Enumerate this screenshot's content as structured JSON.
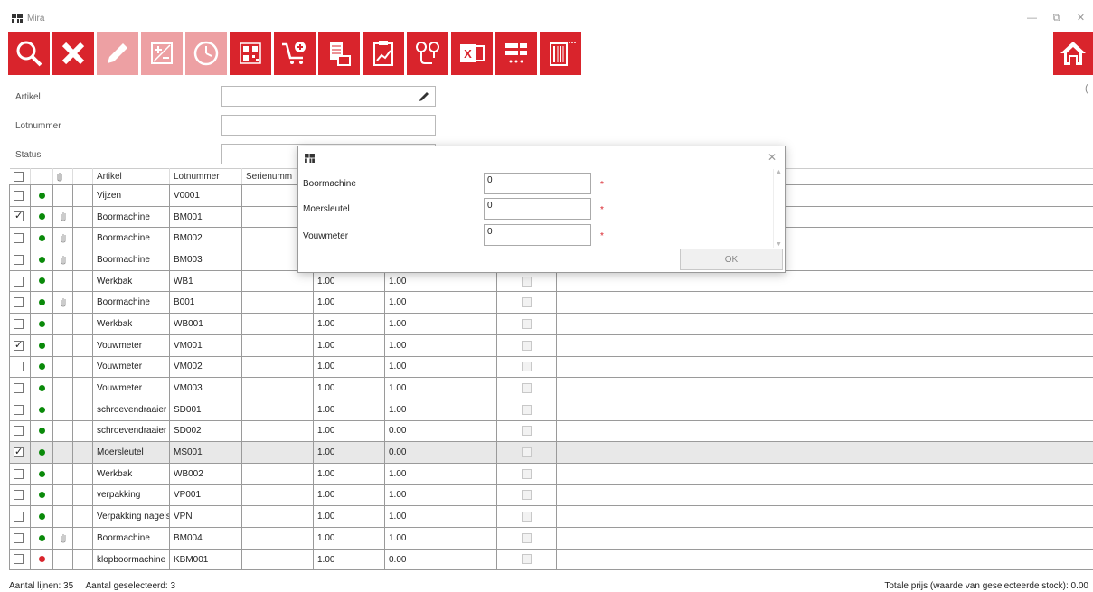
{
  "window": {
    "title": "Mira",
    "minimize": "—",
    "restore": "⧉",
    "close": "✕"
  },
  "toolbar": {
    "buttons": [
      {
        "icon": "search-icon",
        "name": "search-button",
        "disabled": false
      },
      {
        "icon": "close-icon",
        "name": "delete-button",
        "disabled": false
      },
      {
        "icon": "pencil-icon",
        "name": "edit-button",
        "disabled": true
      },
      {
        "icon": "plus-minus-icon",
        "name": "adjust-button",
        "disabled": true
      },
      {
        "icon": "clock-icon",
        "name": "history-button",
        "disabled": true
      },
      {
        "icon": "qr-code-icon",
        "name": "qr-button",
        "disabled": false
      },
      {
        "icon": "cart-add-icon",
        "name": "add-to-cart-button",
        "disabled": false
      },
      {
        "icon": "document-box-icon",
        "name": "document-button",
        "disabled": false
      },
      {
        "icon": "clipboard-chart-icon",
        "name": "report-button",
        "disabled": false
      },
      {
        "icon": "location-route-icon",
        "name": "route-button",
        "disabled": false
      },
      {
        "icon": "excel-icon",
        "name": "excel-button",
        "disabled": false
      },
      {
        "icon": "list-settings-icon",
        "name": "list-settings-button",
        "disabled": false
      },
      {
        "icon": "barcode-icon",
        "name": "barcode-button",
        "disabled": false
      }
    ],
    "home_icon": "home-icon",
    "accent": "#d9242c"
  },
  "filters": {
    "artikel_label": "Artikel",
    "lotnummer_label": "Lotnummer",
    "status_label": "Status",
    "artikel_value": "",
    "lotnummer_value": "",
    "status_value": ""
  },
  "grid": {
    "headers": [
      "Artikel",
      "Lotnummer",
      "Serienumm",
      "",
      "",
      ""
    ],
    "rows": [
      {
        "checked": false,
        "status": "green",
        "clip": false,
        "artikel": "Vijzen",
        "lot": "V0001",
        "serie": "",
        "a": "",
        "b": "",
        "box": false
      },
      {
        "checked": true,
        "status": "green",
        "clip": true,
        "artikel": "Boormachine",
        "lot": "BM001",
        "serie": "",
        "a": "",
        "b": "",
        "box": false
      },
      {
        "checked": false,
        "status": "green",
        "clip": true,
        "artikel": "Boormachine",
        "lot": "BM002",
        "serie": "",
        "a": "",
        "b": "",
        "box": false
      },
      {
        "checked": false,
        "status": "green",
        "clip": true,
        "artikel": "Boormachine",
        "lot": "BM003",
        "serie": "",
        "a": "",
        "b": "",
        "box": false
      },
      {
        "checked": false,
        "status": "green",
        "clip": false,
        "artikel": "Werkbak",
        "lot": "WB1",
        "serie": "",
        "a": "1.00",
        "b": "1.00",
        "box": true
      },
      {
        "checked": false,
        "status": "green",
        "clip": true,
        "artikel": "Boormachine",
        "lot": "B001",
        "serie": "",
        "a": "1.00",
        "b": "1.00",
        "box": true
      },
      {
        "checked": false,
        "status": "green",
        "clip": false,
        "artikel": "Werkbak",
        "lot": "WB001",
        "serie": "",
        "a": "1.00",
        "b": "1.00",
        "box": true
      },
      {
        "checked": true,
        "status": "green",
        "clip": false,
        "artikel": "Vouwmeter",
        "lot": "VM001",
        "serie": "",
        "a": "1.00",
        "b": "1.00",
        "box": true
      },
      {
        "checked": false,
        "status": "green",
        "clip": false,
        "artikel": "Vouwmeter",
        "lot": "VM002",
        "serie": "",
        "a": "1.00",
        "b": "1.00",
        "box": true
      },
      {
        "checked": false,
        "status": "green",
        "clip": false,
        "artikel": "Vouwmeter",
        "lot": "VM003",
        "serie": "",
        "a": "1.00",
        "b": "1.00",
        "box": true
      },
      {
        "checked": false,
        "status": "green",
        "clip": false,
        "artikel": "schroevendraaier",
        "lot": "SD001",
        "serie": "",
        "a": "1.00",
        "b": "1.00",
        "box": true
      },
      {
        "checked": false,
        "status": "green",
        "clip": false,
        "artikel": "schroevendraaier",
        "lot": "SD002",
        "serie": "",
        "a": "1.00",
        "b": "0.00",
        "box": true
      },
      {
        "checked": true,
        "status": "green",
        "clip": false,
        "artikel": "Moersleutel",
        "lot": "MS001",
        "serie": "",
        "a": "1.00",
        "b": "0.00",
        "box": true,
        "selected": true
      },
      {
        "checked": false,
        "status": "green",
        "clip": false,
        "artikel": "Werkbak",
        "lot": "WB002",
        "serie": "",
        "a": "1.00",
        "b": "1.00",
        "box": true
      },
      {
        "checked": false,
        "status": "green",
        "clip": false,
        "artikel": "verpakking",
        "lot": "VP001",
        "serie": "",
        "a": "1.00",
        "b": "1.00",
        "box": true
      },
      {
        "checked": false,
        "status": "green",
        "clip": false,
        "artikel": "Verpakking nagels",
        "lot": "VPN",
        "serie": "",
        "a": "1.00",
        "b": "1.00",
        "box": true
      },
      {
        "checked": false,
        "status": "green",
        "clip": true,
        "artikel": "Boormachine",
        "lot": "BM004",
        "serie": "",
        "a": "1.00",
        "b": "1.00",
        "box": true
      },
      {
        "checked": false,
        "status": "red",
        "clip": false,
        "artikel": "klopboormachine",
        "lot": "KBM001",
        "serie": "",
        "a": "1.00",
        "b": "0.00",
        "box": true
      }
    ],
    "status_colors": {
      "green": "#0a8a0a",
      "red": "#d9242c"
    }
  },
  "dialog": {
    "close": "✕",
    "fields": [
      {
        "label": "Boormachine",
        "value": "0",
        "required": "*"
      },
      {
        "label": "Moersleutel",
        "value": "0",
        "required": "*"
      },
      {
        "label": "Vouwmeter",
        "value": "0",
        "required": "*"
      }
    ],
    "ok_label": "OK"
  },
  "footer": {
    "aantal_lijnen": "Aantal lijnen:  35",
    "aantal_geselecteerd": "Aantal geselecteerd:  3",
    "totale_prijs": "Totale prijs (waarde van geselecteerde stock):  0.00"
  }
}
